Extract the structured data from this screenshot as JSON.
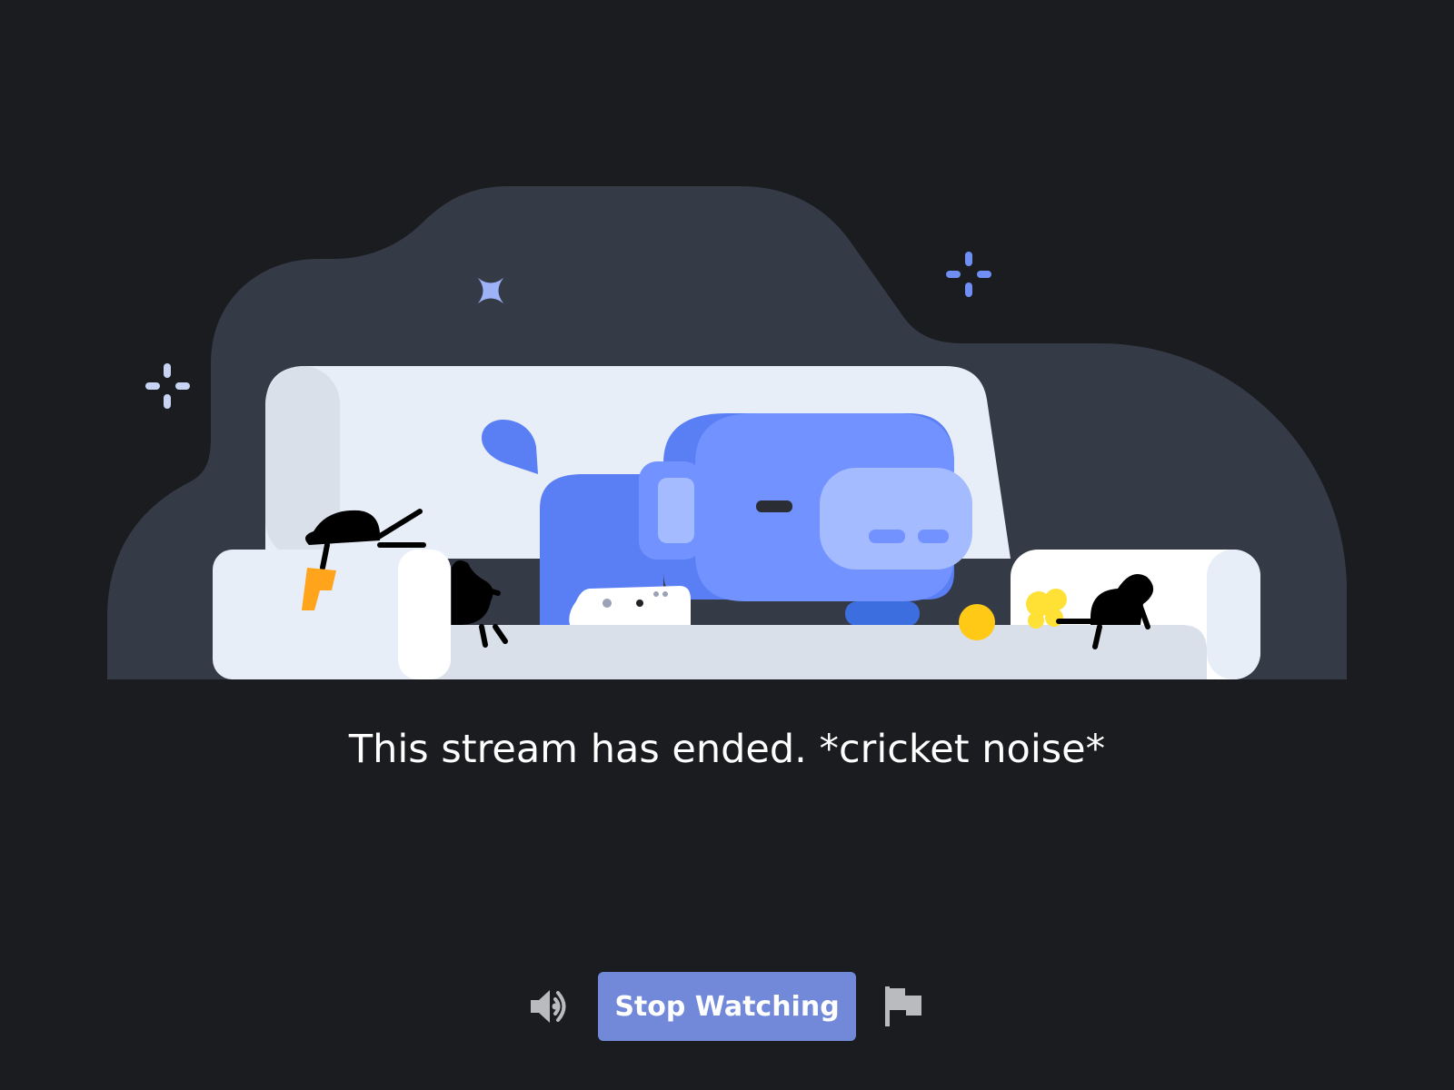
{
  "stream_ended": {
    "message": "This stream has ended. *cricket noise*"
  },
  "controls": {
    "volume_icon": "speaker-icon",
    "stop_label": "Stop Watching",
    "report_icon": "flag-icon"
  },
  "colors": {
    "background": "#1a1c1f",
    "blob": "#353a47",
    "button": "#7289da",
    "blurple": "#5a7ff5",
    "couch": "#e8eef8"
  }
}
